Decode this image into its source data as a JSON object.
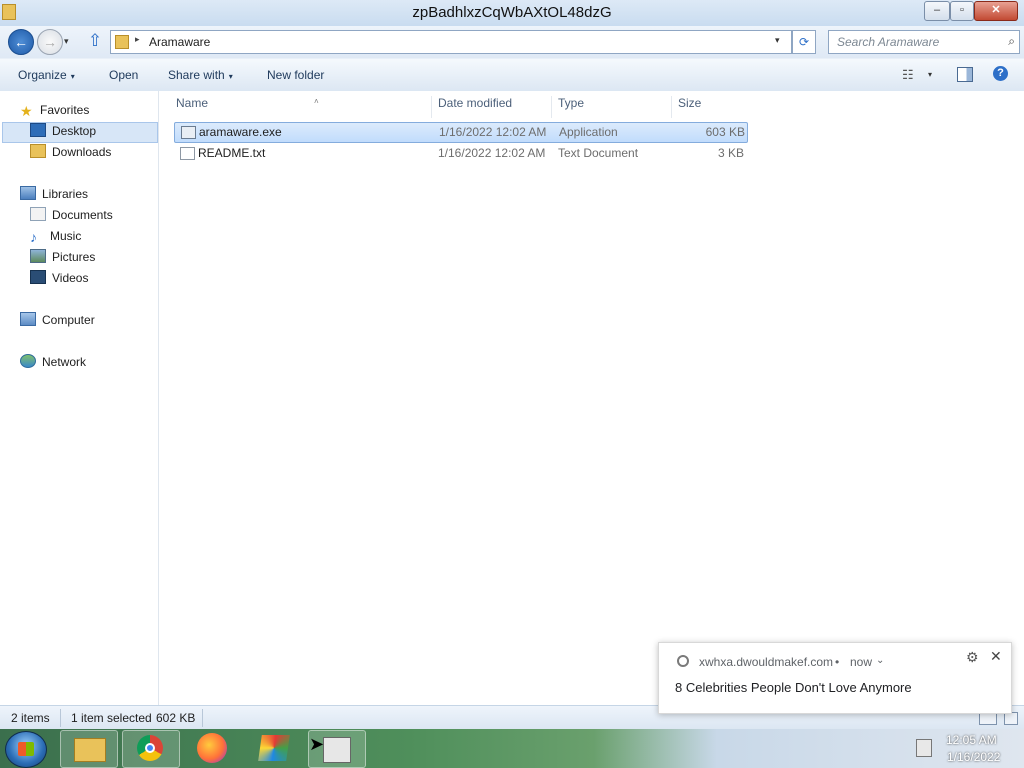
{
  "window": {
    "title": "zpBadhlxzCqWbAXtOL48dzG",
    "minimize": "–",
    "maximize": "▫",
    "close": "✕"
  },
  "address": {
    "path": "Aramaware",
    "search_placeholder": "Search Aramaware",
    "back": "←",
    "forward": "→",
    "up": "⇧",
    "refresh": "⟳",
    "sep": "▸",
    "dd": "▾"
  },
  "toolbar": {
    "organize": "Organize",
    "open": "Open",
    "share_with": "Share with",
    "new_folder": "New folder",
    "caret": "▾",
    "help": "?"
  },
  "nav": {
    "favorites": "Favorites",
    "desktop": "Desktop",
    "downloads": "Downloads",
    "libraries": "Libraries",
    "documents": "Documents",
    "music": "Music",
    "pictures": "Pictures",
    "videos": "Videos",
    "computer": "Computer",
    "network": "Network"
  },
  "columns": {
    "name": "Name",
    "date": "Date modified",
    "type": "Type",
    "size": "Size"
  },
  "files": [
    {
      "name": "aramaware.exe",
      "date": "1/16/2022 12:02 AM",
      "type": "Application",
      "size": "603 KB",
      "selected": true
    },
    {
      "name": "README.txt",
      "date": "1/16/2022 12:02 AM",
      "type": "Text Document",
      "size": "3 KB",
      "selected": false
    }
  ],
  "status": {
    "items": "2 items",
    "selected": "1 item selected",
    "size": "602 KB"
  },
  "notification": {
    "site": "xwhxa.dwouldmakef.com",
    "dot": "•",
    "time": "now",
    "chevron": "⌄",
    "gear": "⚙",
    "close": "✕",
    "message": "8 Celebrities People Don't Love Anymore"
  },
  "clock": {
    "time": "12:05 AM",
    "date": "1/16/2022"
  }
}
